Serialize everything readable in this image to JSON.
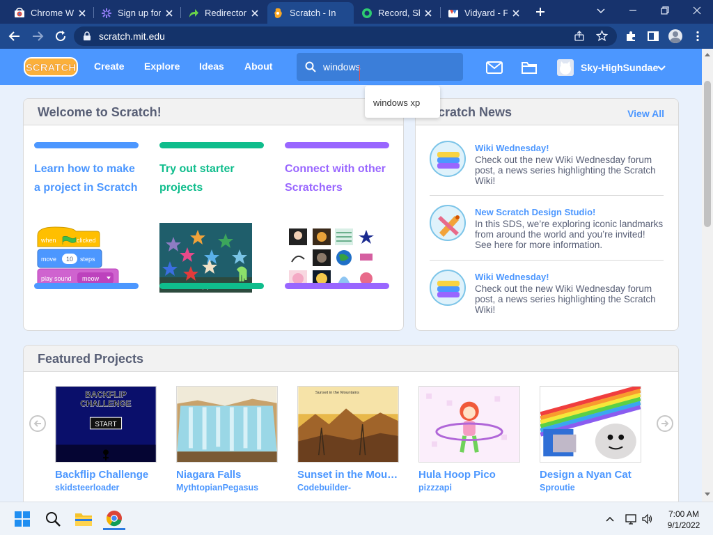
{
  "colors": {
    "chrome_frame": "#17336d",
    "chrome_toolbar": "#1f4a8f",
    "scratch_blue": "#4c97ff",
    "teal": "#0fbd8c",
    "purple": "#9966ff"
  },
  "browser": {
    "tabs": [
      {
        "label": "Chrome We",
        "icon": "chrome-web-store-icon"
      },
      {
        "label": "Sign up for",
        "icon": "gear-flower-icon"
      },
      {
        "label": "Redirector",
        "icon": "redirect-arrow-icon"
      },
      {
        "label": "Scratch - In",
        "icon": "scratch-favicon-icon",
        "active": true
      },
      {
        "label": "Record, Sha",
        "icon": "record-icon"
      },
      {
        "label": "Vidyard - F",
        "icon": "vidyard-icon"
      }
    ],
    "url": "scratch.mit.edu"
  },
  "nav": {
    "logo_text": "SCRATCH",
    "links": [
      "Create",
      "Explore",
      "Ideas",
      "About"
    ],
    "search_value": "windows",
    "username": "Sky-HighSundae"
  },
  "suggestion": "windows xp",
  "welcome": {
    "title": "Welcome to Scratch!",
    "columns": [
      {
        "title_line1": "Learn how to make",
        "title_line2": "a project in Scratch"
      },
      {
        "title_line1": "Try out starter",
        "title_line2": "projects"
      },
      {
        "title_line1": "Connect with other",
        "title_line2": "Scratchers"
      }
    ],
    "blocks": {
      "when": "when",
      "clicked": "clicked",
      "move": "move",
      "steps_value": "10",
      "steps": "steps",
      "play_sound": "play sound",
      "sound": "meow"
    },
    "starter_caption": "Click the sea creatures to play the orchestra"
  },
  "news": {
    "title": "Scratch News",
    "view_all": "View All",
    "items": [
      {
        "title": "Wiki Wednesday!",
        "text": "Check out the new Wiki Wednesday forum post, a news series highlighting the Scratch Wiki!"
      },
      {
        "title": "New Scratch Design Studio!",
        "text": "In this SDS, we’re exploring iconic landmarks from around the world and you’re invited! See here for more information."
      },
      {
        "title": "Wiki Wednesday!",
        "text": "Check out the new Wiki Wednesday forum post, a news series highlighting the Scratch Wiki!"
      }
    ]
  },
  "featured": {
    "title": "Featured Projects",
    "thumb_text": {
      "backflip_line1": "BACKFLIP",
      "backflip_line2": "CHALLENGE",
      "start": "START",
      "sunset": "Sunset in the Mountains"
    },
    "projects": [
      {
        "title": "Backflip Challenge",
        "author": "skidsteerloader"
      },
      {
        "title": "Niagara Falls",
        "author": "MythtopianPegasus"
      },
      {
        "title": "Sunset in the Mountains",
        "author": "Codebuilder-"
      },
      {
        "title": "Hula Hoop Pico",
        "author": "pizzzapi"
      },
      {
        "title": "Design a Nyan Cat",
        "author": "Sproutie"
      }
    ]
  },
  "taskbar": {
    "time": "7:00 AM",
    "date": "9/1/2022"
  }
}
